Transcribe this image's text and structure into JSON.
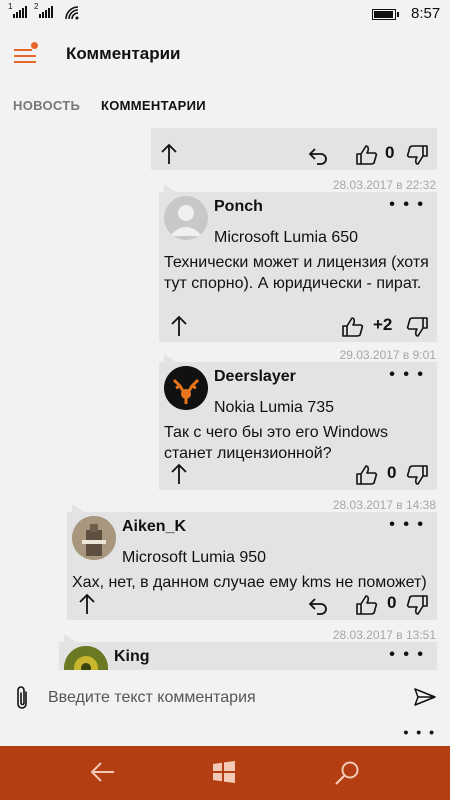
{
  "status_bar": {
    "sim1": "1",
    "sim2": "2",
    "time": "8:57",
    "icons": [
      "signal-icon",
      "signal-icon",
      "wifi-icon",
      "battery-icon"
    ]
  },
  "header": {
    "title": "Комментарии",
    "menu_icon": "hamburger-menu-icon",
    "accent": "#e8662c"
  },
  "tabs": [
    {
      "label": "НОВОСТЬ",
      "active": false
    },
    {
      "label": "КОММЕНТАРИИ",
      "active": true
    }
  ],
  "comments": [
    {
      "score": "0"
    },
    {
      "date": "28.03.2017 в 22:32",
      "author": "Ponch",
      "device": "Microsoft Lumia 650",
      "text": "Технически может и лицензия (хотя тут спорно). А юридически - пират.",
      "score": "+2"
    },
    {
      "date": "29.03.2017 в 9:01",
      "author": "Deerslayer",
      "device": "Nokia Lumia 735",
      "text": "Так с чего бы это его Windows станет лицензионной?",
      "score": "0"
    },
    {
      "date": "28.03.2017 в 14:38",
      "author": "Aiken_K",
      "device": "Microsoft Lumia 950",
      "text": "Хах, нет, в данном случае ему kms не поможет)",
      "score": "0"
    },
    {
      "date": "28.03.2017 в 13:51",
      "author": "King"
    }
  ],
  "more_label": "• • •",
  "input": {
    "placeholder": "Введите текст комментария",
    "value": ""
  },
  "nav_bar": {
    "color": "#b23e12",
    "icons": [
      "back-arrow-icon",
      "windows-start-icon",
      "search-icon"
    ]
  }
}
